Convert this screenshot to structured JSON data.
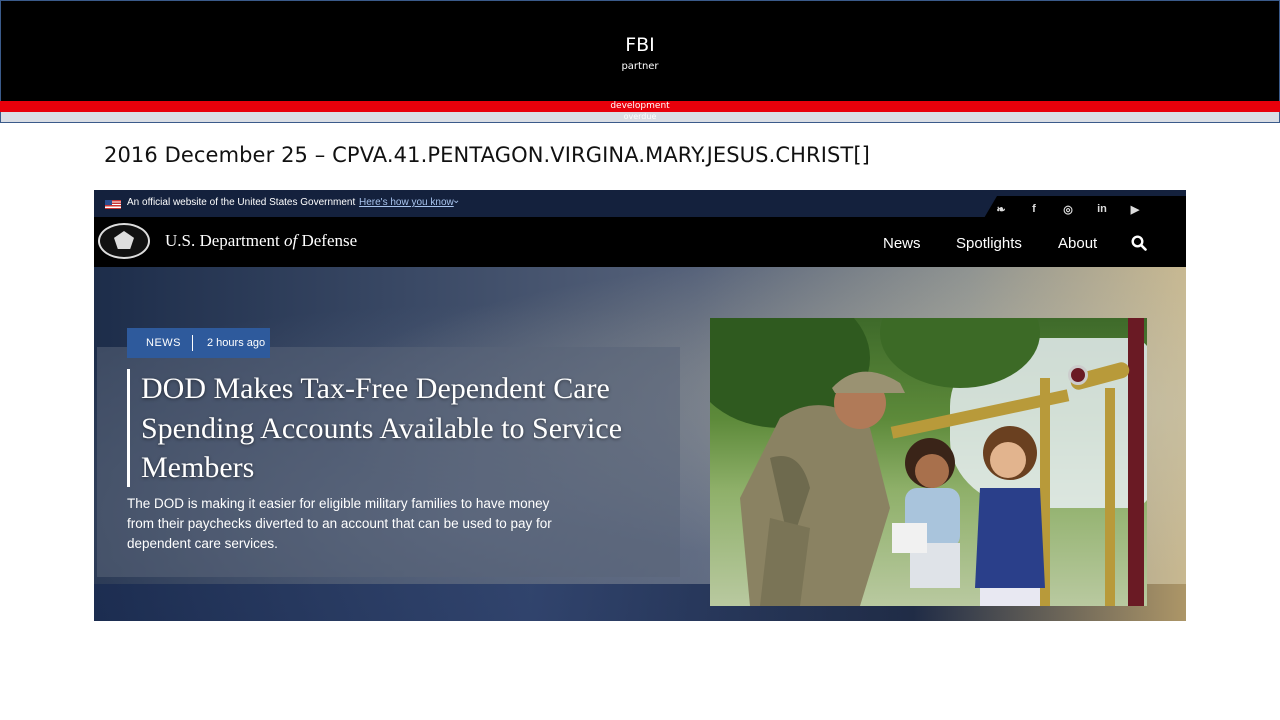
{
  "slide": {
    "header_title": "FBI",
    "header_subtitle": "partner",
    "red_bar_text": "development",
    "grey_bar_text": "overdue",
    "title": "2016 December 25 – CPVA.41.PENTAGON.VIRGINA.MARY.JESUS.CHRIST[]"
  },
  "website": {
    "gov_banner": {
      "text": "An official website of the United States Government",
      "link": "Here's how you know"
    },
    "social_icons": [
      "twitter-icon",
      "facebook-icon",
      "instagram-icon",
      "linkedin-icon",
      "youtube-icon"
    ],
    "social_glyphs": [
      "❧",
      "f",
      "◎",
      "in",
      "▶"
    ],
    "logo_text_before": "U.S. Department",
    "logo_text_of": "of",
    "logo_text_after": "Defense",
    "nav": [
      "News",
      "Spotlights",
      "About"
    ],
    "hero": {
      "tag": "NEWS",
      "time": "2 hours ago",
      "headline": "DOD Makes Tax-Free Dependent Care Spending Accounts Available to Service Members",
      "summary": "The DOD is making it easier for eligible military families to have money from their paychecks diverted to an account that can be used to pay for dependent care services."
    }
  },
  "colors": {
    "header_bg": "#000000",
    "red_bar": "#e8000b",
    "gov_banner_bg": "#14213d",
    "tag_bg": "#2e5a9c"
  }
}
